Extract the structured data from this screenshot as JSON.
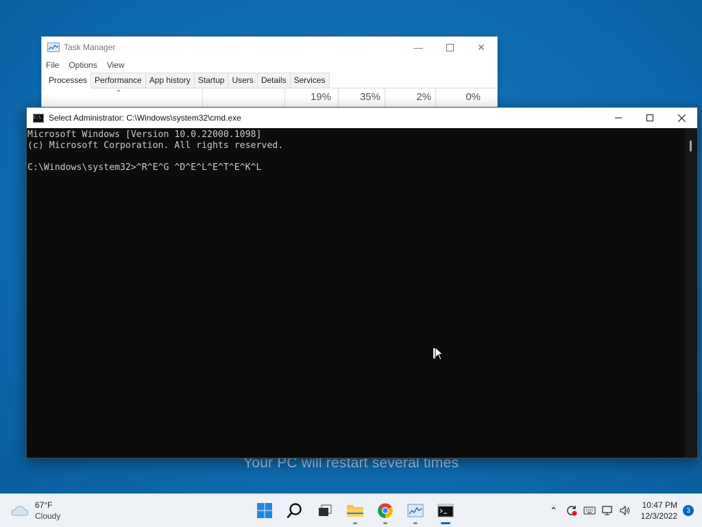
{
  "desktop": {
    "restart_message": "Your PC will restart several times"
  },
  "task_manager": {
    "title": "Task Manager",
    "menu": [
      "File",
      "Options",
      "View"
    ],
    "tabs": [
      "Processes",
      "Performance",
      "App history",
      "Startup",
      "Users",
      "Details",
      "Services"
    ],
    "active_tab": "Processes",
    "columns": {
      "cpu": "19%",
      "memory": "35%",
      "disk": "2%",
      "network": "0%"
    }
  },
  "cmd": {
    "title": "Select Administrator: C:\\Windows\\system32\\cmd.exe",
    "icon_text": "C:\\",
    "lines": [
      "Microsoft Windows [Version 10.0.22000.1098]",
      "(c) Microsoft Corporation. All rights reserved.",
      "",
      "C:\\Windows\\system32>^R^E^G ^D^E^L^E^T^E^K^L"
    ]
  },
  "taskbar": {
    "weather": {
      "temp": "67°F",
      "condition": "Cloudy"
    },
    "apps": [
      "start-icon",
      "search-icon",
      "task-view-icon",
      "file-explorer-icon",
      "chrome-icon",
      "task-manager-icon",
      "cmd-icon"
    ],
    "clock": {
      "time": "10:47 PM",
      "date": "12/3/2022"
    },
    "notification_count": "3"
  },
  "colors": {
    "desktop": "#0e6cb0",
    "console_bg": "#0c0c0c",
    "console_fg": "#cccccc",
    "accent": "#0067c0"
  }
}
